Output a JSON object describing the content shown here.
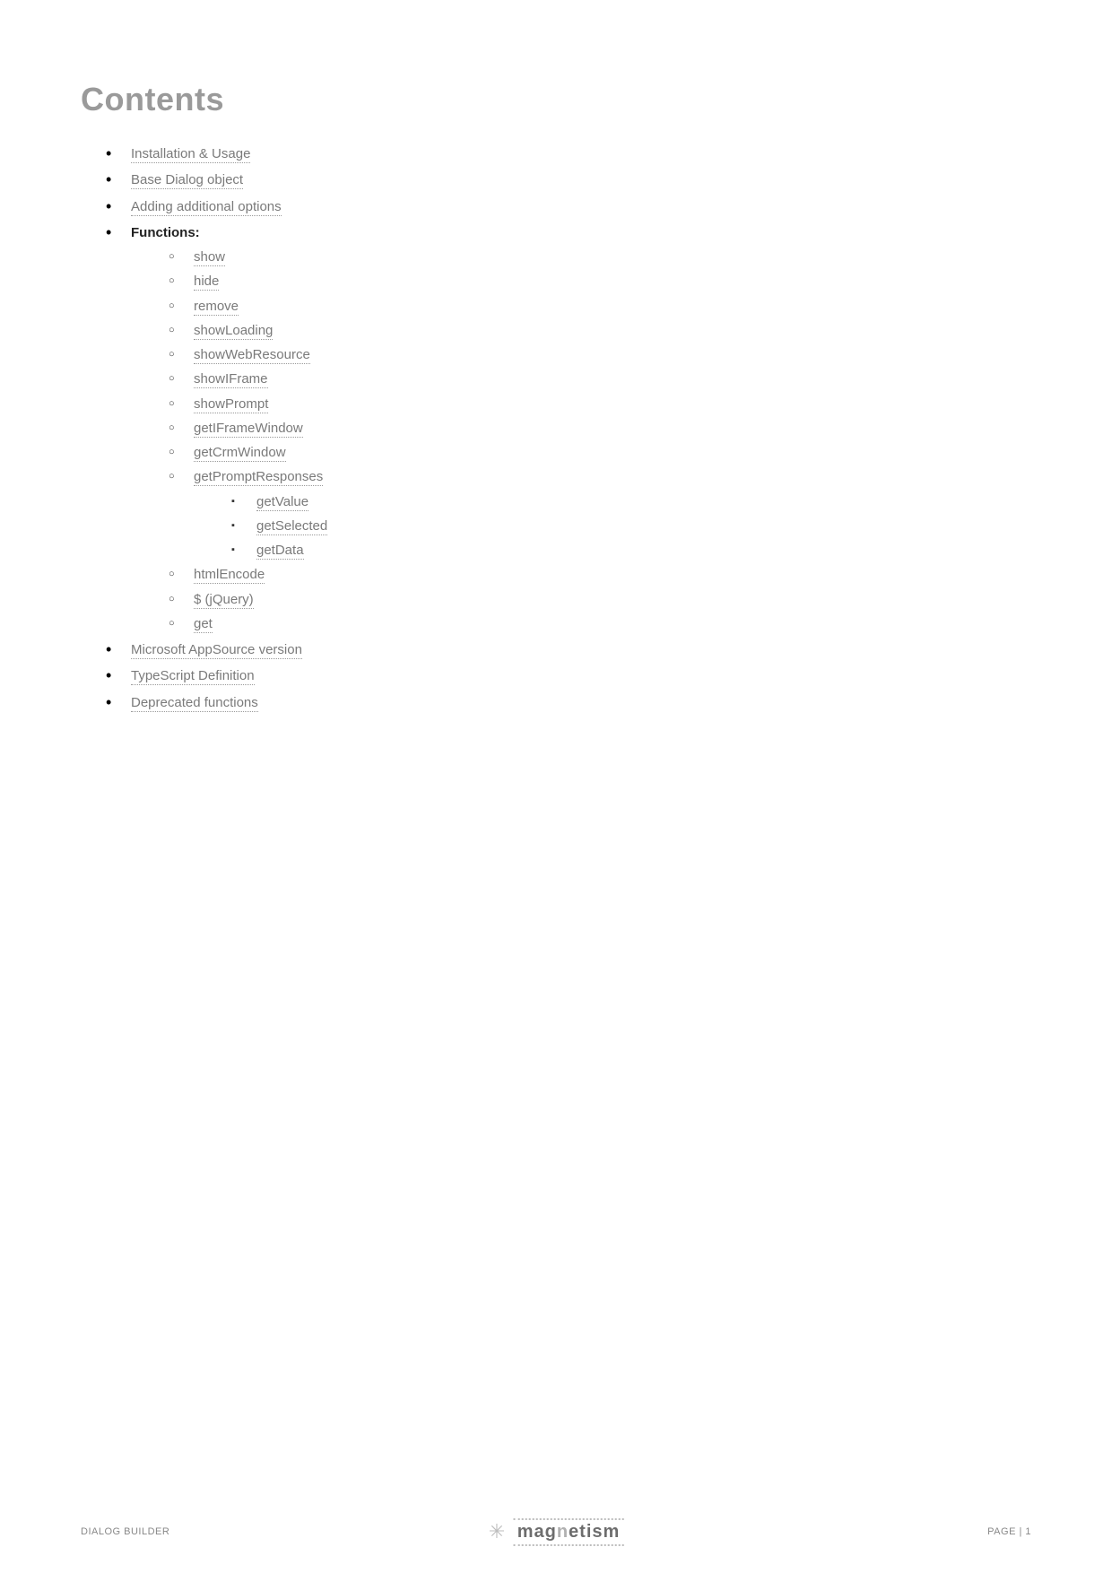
{
  "heading": "Contents",
  "toc": [
    {
      "label": "Installation & Usage",
      "link": true
    },
    {
      "label": "Base Dialog object",
      "link": true
    },
    {
      "label": "Adding additional options",
      "link": true
    },
    {
      "label": "Functions:",
      "link": false,
      "bold": true,
      "children": [
        {
          "label": "show",
          "link": true
        },
        {
          "label": "hide",
          "link": true
        },
        {
          "label": "remove",
          "link": true
        },
        {
          "label": "showLoading",
          "link": true
        },
        {
          "label": "showWebResource",
          "link": true
        },
        {
          "label": "showIFrame",
          "link": true
        },
        {
          "label": "showPrompt",
          "link": true
        },
        {
          "label": "getIFrameWindow",
          "link": true
        },
        {
          "label": "getCrmWindow",
          "link": true
        },
        {
          "label": "getPromptResponses",
          "link": true,
          "children": [
            {
              "label": "getValue",
              "link": true
            },
            {
              "label": "getSelected",
              "link": true
            },
            {
              "label": "getData",
              "link": true
            }
          ]
        },
        {
          "label": "htmlEncode",
          "link": true
        },
        {
          "label": "$ (jQuery)",
          "link": true
        },
        {
          "label": "get",
          "link": true
        }
      ]
    },
    {
      "label": "Microsoft AppSource version",
      "link": true
    },
    {
      "label": "TypeScript Definition",
      "link": true
    },
    {
      "label": "Deprecated functions",
      "link": true
    }
  ],
  "footer": {
    "left": "DIALOG BUILDER",
    "brand_prefix": "mag",
    "brand_accent": "n",
    "brand_suffix": "etism",
    "right": "PAGE | 1"
  }
}
